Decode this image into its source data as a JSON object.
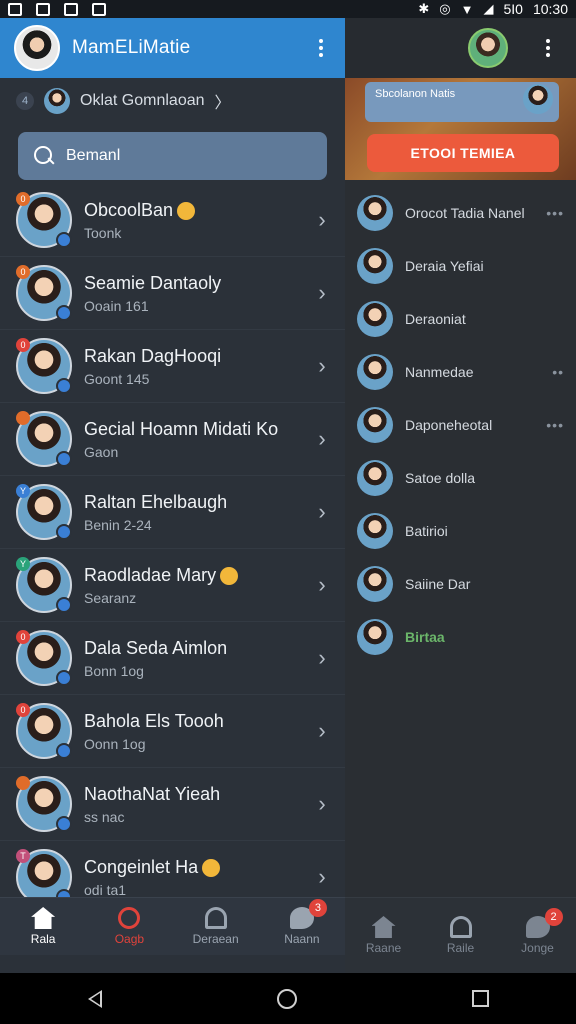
{
  "status_bar": {
    "time": "10:30",
    "signal": "5I0",
    "icons": [
      "bluetooth-icon",
      "alarm-icon",
      "wifi-icon",
      "signal-icon"
    ]
  },
  "left": {
    "app_title": "MamELiMatie",
    "crumb": {
      "count": "4",
      "label": "Oklat Gomnlaoan",
      "chevron": "〉"
    },
    "search": {
      "prefix": "Q ?",
      "value": "Bemanl"
    },
    "chats": [
      {
        "name": "ObcoolBan",
        "sub": "Toonk",
        "badge": "0",
        "badge_color": "#e06c2a",
        "emoji": true
      },
      {
        "name": "Seamie Dantaoly",
        "sub": "Ooain 161",
        "badge": "0",
        "badge_color": "#e06c2a",
        "emoji": false
      },
      {
        "name": "Rakan DagHooqi",
        "sub": "Goont 145",
        "badge": "0",
        "badge_color": "#e0433b",
        "emoji": false
      },
      {
        "name": "Gecial Hoamn Midati Ko",
        "sub": "Gaon",
        "badge": "",
        "badge_color": "#e06c2a",
        "emoji": false
      },
      {
        "name": "Raltan Ehelbaugh",
        "sub": "Benin 2-24",
        "badge": "Y",
        "badge_color": "#3a7fd5",
        "emoji": false
      },
      {
        "name": "Raodladae Mary",
        "sub": "Searanz",
        "badge": "Y",
        "badge_color": "#2aa37a",
        "emoji": true
      },
      {
        "name": "Dala Seda Aimlon",
        "sub": "Bonn 1og",
        "badge": "0",
        "badge_color": "#e0433b",
        "emoji": false
      },
      {
        "name": "Bahola Els Toooh",
        "sub": "Oonn 1og",
        "badge": "0",
        "badge_color": "#e0433b",
        "emoji": false
      },
      {
        "name": "NaothaNat Yieah",
        "sub": "ss nac",
        "badge": "",
        "badge_color": "#e06c2a",
        "emoji": false
      },
      {
        "name": "Congeinlet Ha",
        "sub": "odi ta1",
        "badge": "T",
        "badge_color": "#c2507a",
        "emoji": true
      }
    ],
    "nav": [
      {
        "label": "Rala",
        "icon": "home-icon",
        "state": "active"
      },
      {
        "label": "Oagb",
        "icon": "ring-icon",
        "state": "alert"
      },
      {
        "label": "Deraean",
        "icon": "person-icon",
        "state": ""
      },
      {
        "label": "Naann",
        "icon": "chat-icon",
        "state": "",
        "count": "3"
      }
    ]
  },
  "right": {
    "banner_text": "Sbcolanon Natis",
    "cta_label": "ETOOI TEMIEA",
    "contacts": [
      {
        "name": "Orocot Tadia Nanel",
        "more": "•••"
      },
      {
        "name": "Deraia Yefiai",
        "more": ""
      },
      {
        "name": "Deraoniat",
        "more": ""
      },
      {
        "name": "Nanmedae",
        "more": "••"
      },
      {
        "name": "Daponeheotal",
        "more": "•••"
      },
      {
        "name": "Satoe dolla",
        "more": ""
      },
      {
        "name": "Batirioi",
        "more": ""
      },
      {
        "name": "Saiine Dar",
        "more": ""
      },
      {
        "name": "Birtaa",
        "more": ""
      }
    ],
    "nav": [
      {
        "label": "Raane",
        "icon": "home-icon"
      },
      {
        "label": "Raile",
        "icon": "ring-icon"
      },
      {
        "label": "Jonge",
        "icon": "chat-icon",
        "count": "2"
      }
    ]
  }
}
